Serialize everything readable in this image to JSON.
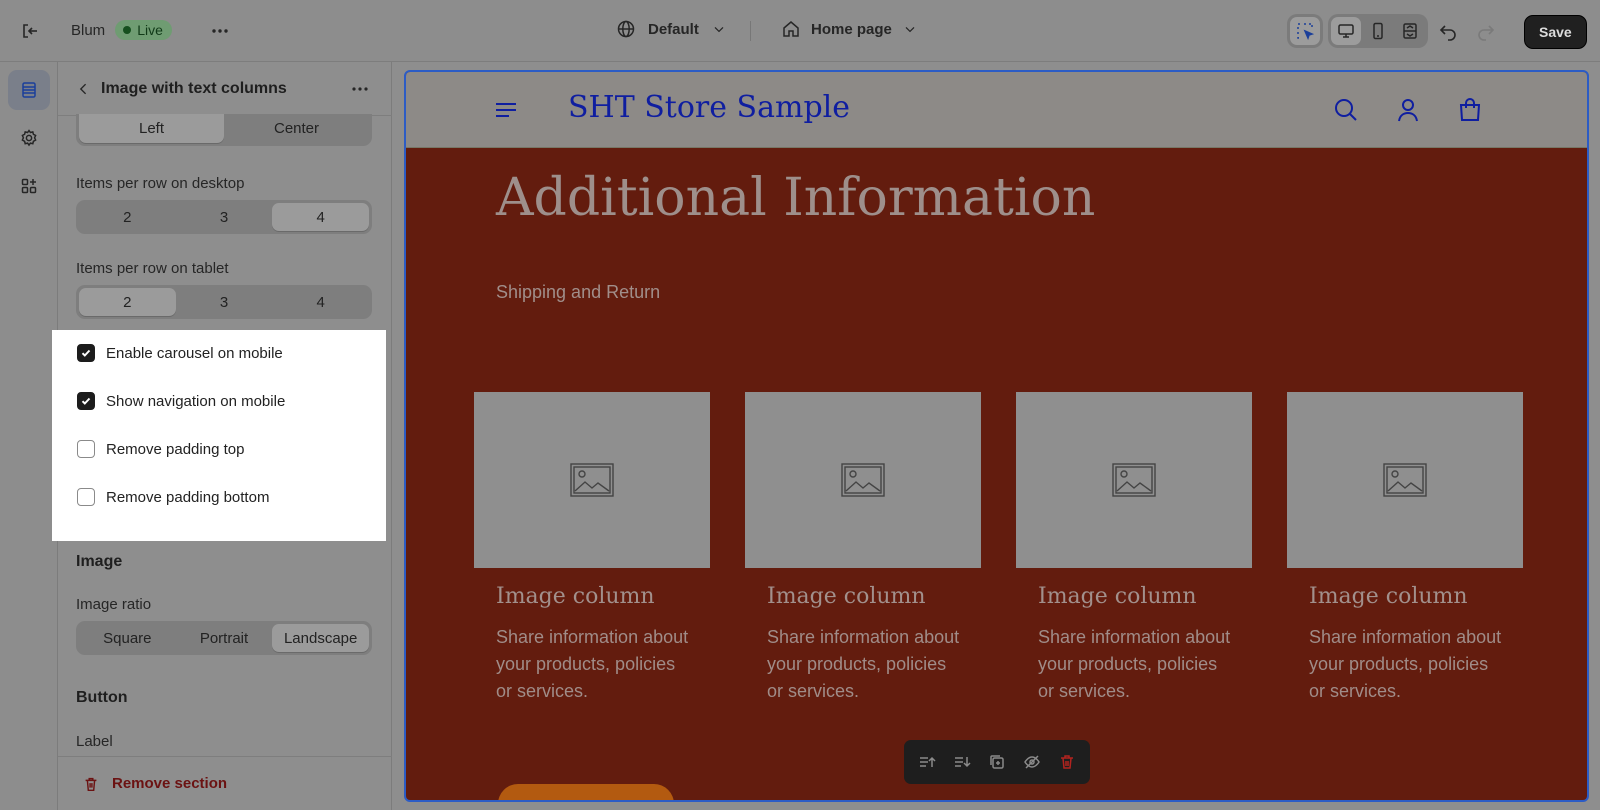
{
  "topbar": {
    "store_name": "Blum",
    "status_badge": "Live",
    "theme_selector": "Default",
    "page_selector": "Home page",
    "save_label": "Save"
  },
  "panel": {
    "title": "Image with text columns",
    "alignment_options": [
      "Left",
      "Center"
    ],
    "alignment_selected": "Left",
    "desktop_label": "Items per row on desktop",
    "desktop_options": [
      "2",
      "3",
      "4"
    ],
    "desktop_selected": "4",
    "tablet_label": "Items per row on tablet",
    "tablet_options": [
      "2",
      "3",
      "4"
    ],
    "tablet_selected": "2",
    "checkboxes": [
      {
        "label": "Enable carousel on mobile",
        "checked": true
      },
      {
        "label": "Show navigation on mobile",
        "checked": true
      },
      {
        "label": "Remove padding top",
        "checked": false
      },
      {
        "label": "Remove padding bottom",
        "checked": false
      }
    ],
    "image_section": "Image",
    "image_ratio_label": "Image ratio",
    "image_ratio_options": [
      "Square",
      "Portrait",
      "Landscape"
    ],
    "image_ratio_selected": "Landscape",
    "button_section": "Button",
    "button_label": "Label",
    "remove_section": "Remove section"
  },
  "preview": {
    "store_title": "SHT Store Sample",
    "heading": "Additional Information",
    "subheading": "Shipping and Return",
    "columns": [
      {
        "title": "Image column",
        "text": "Share information about your products, policies or services."
      },
      {
        "title": "Image column",
        "text": "Share information about your products, policies or services."
      },
      {
        "title": "Image column",
        "text": "Share information about your products, policies or services."
      },
      {
        "title": "Image column",
        "text": "Share information about your products, policies or services."
      }
    ]
  },
  "colors": {
    "accent_blue": "#2c5cc5",
    "store_title": "#0f1ea0",
    "section_bg": "#631c0e",
    "danger": "#6b1212"
  }
}
